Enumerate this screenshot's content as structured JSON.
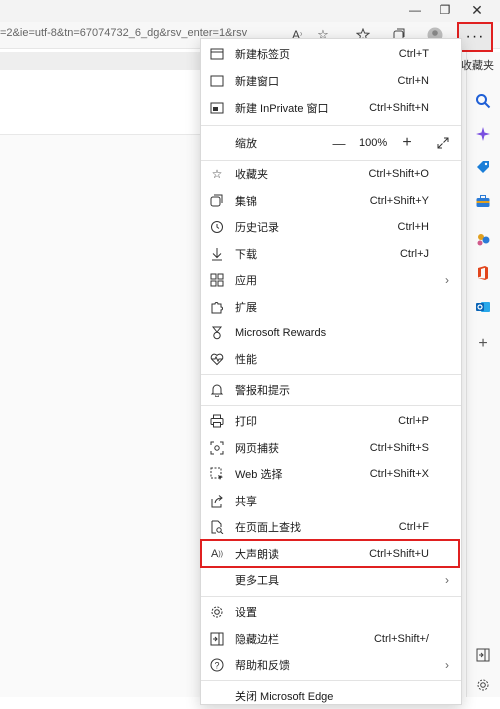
{
  "window": {
    "minimize": "—",
    "restore": "❐",
    "more": "···"
  },
  "address": {
    "url": "=2&ie=utf-8&tn=67074732_6_dg&rsv_enter=1&rsv",
    "read_aloud_icon": "A",
    "star_icon": "☆"
  },
  "sidebar": {
    "favorites_label": "收藏夹"
  },
  "menu": {
    "new_tab": {
      "label": "新建标签页",
      "shortcut": "Ctrl+T"
    },
    "new_window": {
      "label": "新建窗口",
      "shortcut": "Ctrl+N"
    },
    "new_inprivate": {
      "label": "新建 InPrivate 窗口",
      "shortcut": "Ctrl+Shift+N"
    },
    "zoom": {
      "label": "缩放",
      "minus": "—",
      "value": "100%",
      "plus": "+"
    },
    "favorites": {
      "label": "收藏夹",
      "shortcut": "Ctrl+Shift+O"
    },
    "collections": {
      "label": "集锦",
      "shortcut": "Ctrl+Shift+Y"
    },
    "history": {
      "label": "历史记录",
      "shortcut": "Ctrl+H"
    },
    "downloads": {
      "label": "下载",
      "shortcut": "Ctrl+J"
    },
    "apps": {
      "label": "应用"
    },
    "extensions": {
      "label": "扩展"
    },
    "rewards": {
      "label": "Microsoft Rewards"
    },
    "performance": {
      "label": "性能"
    },
    "alerts": {
      "label": "警报和提示"
    },
    "print": {
      "label": "打印",
      "shortcut": "Ctrl+P"
    },
    "web_capture": {
      "label": "网页捕获",
      "shortcut": "Ctrl+Shift+S"
    },
    "web_select": {
      "label": "Web 选择",
      "shortcut": "Ctrl+Shift+X"
    },
    "share": {
      "label": "共享"
    },
    "find": {
      "label": "在页面上查找",
      "shortcut": "Ctrl+F"
    },
    "read_aloud": {
      "label": "大声朗读",
      "shortcut": "Ctrl+Shift+U"
    },
    "more_tools": {
      "label": "更多工具"
    },
    "settings": {
      "label": "设置"
    },
    "hide_sidebar": {
      "label": "隐藏边栏",
      "shortcut": "Ctrl+Shift+/"
    },
    "help": {
      "label": "帮助和反馈"
    },
    "close": {
      "label": "关闭 Microsoft Edge"
    }
  }
}
